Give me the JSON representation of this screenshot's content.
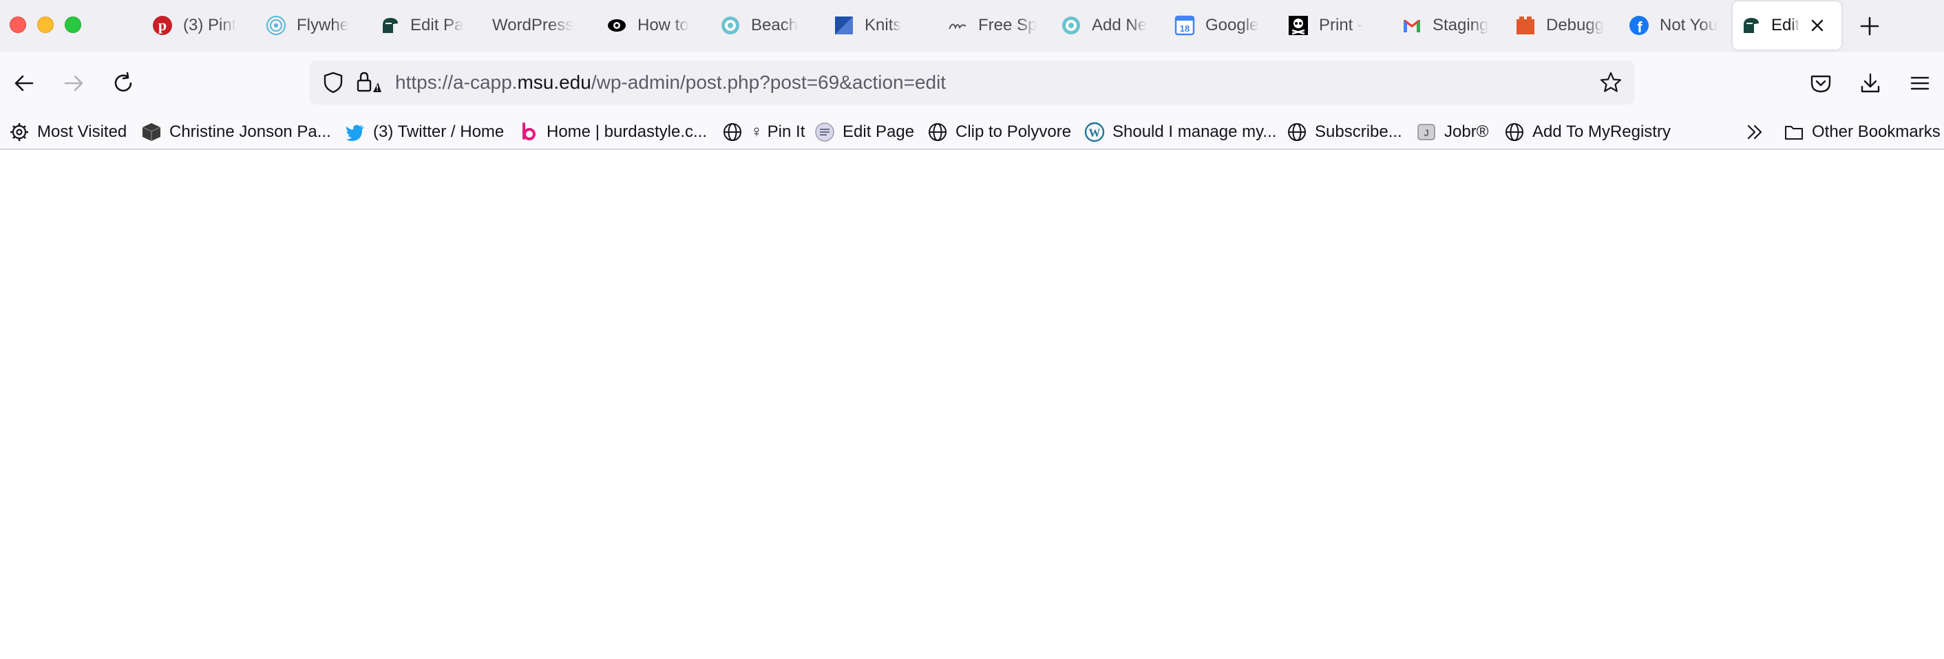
{
  "tabs": [
    {
      "title": "(3) Pint",
      "icon": "pinterest-icon",
      "color": "#cb1f27"
    },
    {
      "title": "Flywhe",
      "icon": "flywheel-icon",
      "color": "#5bb5d9"
    },
    {
      "title": "Edit Pa",
      "icon": "spartan-helmet-icon",
      "color": "#18453b"
    },
    {
      "title": "WordPress",
      "icon": "",
      "color": ""
    },
    {
      "title": "How to",
      "icon": "eye-icon",
      "color": "#000000"
    },
    {
      "title": "Beach",
      "icon": "circle-logo-icon",
      "color": "#6cc3cf"
    },
    {
      "title": "Knits",
      "icon": "blue-square-icon",
      "color": "#1f4fa8"
    },
    {
      "title": "Free Sp",
      "icon": "script-logo-icon",
      "color": "#555555"
    },
    {
      "title": "Add Ne",
      "icon": "circle-logo-icon",
      "color": "#6cc3cf"
    },
    {
      "title": "Google",
      "icon": "google-calendar-icon",
      "color": "#4285f4"
    },
    {
      "title": "Print -",
      "icon": "skull-icon",
      "color": "#000000"
    },
    {
      "title": "Staging",
      "icon": "gmail-icon",
      "color": "#ea4335"
    },
    {
      "title": "Debugg",
      "icon": "orange-block-icon",
      "color": "#e0592a"
    },
    {
      "title": "Not You",
      "icon": "facebook-icon",
      "color": "#1877f2"
    },
    {
      "title": "Edit",
      "icon": "spartan-helmet-icon",
      "color": "#18453b"
    }
  ],
  "calendar_badge": "18",
  "url": {
    "prefix": "https://a-capp.",
    "domain": "msu.edu",
    "path": "/wp-admin/post.php?post=69&action=edit"
  },
  "bookmarks": [
    {
      "label": "Most Visited",
      "icon": "gear-icon"
    },
    {
      "label": "Christine Jonson Pa...",
      "icon": "cube-icon"
    },
    {
      "label": "(3) Twitter / Home",
      "icon": "twitter-icon"
    },
    {
      "label": "Home | burdastyle.c...",
      "icon": "burda-icon"
    },
    {
      "label": "♀ Pin It",
      "icon": "globe-icon"
    },
    {
      "label": "Edit Page",
      "icon": "wp-edit-icon"
    },
    {
      "label": "Clip to Polyvore",
      "icon": "globe-icon"
    },
    {
      "label": "Should I manage my...",
      "icon": "wordpress-icon"
    },
    {
      "label": "Subscribe...",
      "icon": "globe-icon"
    },
    {
      "label": "Jobr®",
      "icon": "jobr-icon"
    },
    {
      "label": "Add To MyRegistry",
      "icon": "globe-icon"
    },
    {
      "label": "Other Bookmarks",
      "icon": "folder-icon"
    }
  ],
  "colors": {
    "tabbar": "#f0f0f4",
    "toolbar": "#f9f9fb",
    "text": "#15141a",
    "muted": "#5b5b66"
  }
}
